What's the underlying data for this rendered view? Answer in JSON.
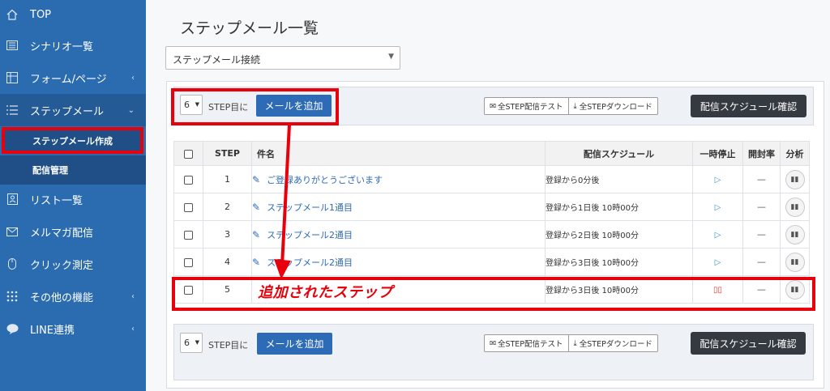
{
  "sidebar": {
    "items": [
      {
        "label": "TOP",
        "icon": "home-icon"
      },
      {
        "label": "シナリオ一覧",
        "icon": "list-icon"
      },
      {
        "label": "フォーム/ページ",
        "icon": "form-icon"
      },
      {
        "label": "ステップメール",
        "icon": "steps-icon"
      },
      {
        "label": "リスト一覧",
        "icon": "contacts-icon"
      },
      {
        "label": "メルマガ配信",
        "icon": "mail-icon"
      },
      {
        "label": "クリック測定",
        "icon": "mouse-icon"
      },
      {
        "label": "その他の機能",
        "icon": "grid-icon"
      },
      {
        "label": "LINE連携",
        "icon": "line-chat-icon"
      }
    ],
    "sub_items": [
      {
        "label": "ステップメール作成"
      },
      {
        "label": "配信管理"
      }
    ]
  },
  "page": {
    "title": "ステップメール一覧",
    "selector_value": "ステップメール接続"
  },
  "toolbar": {
    "step_value": "6",
    "step_suffix": "STEP目に",
    "add_mail": "メールを追加",
    "test_all": "全STEP配信テスト",
    "download_all": "全STEPダウンロード",
    "schedule_confirm": "配信スケジュール確認"
  },
  "table": {
    "headers": {
      "step": "STEP",
      "subject": "件名",
      "schedule": "配信スケジュール",
      "pause": "一時停止",
      "open_rate": "開封率",
      "analysis": "分析"
    },
    "rows": [
      {
        "step": "1",
        "subject": "ご登録ありがとうございます",
        "schedule": "登録から0分後",
        "paused": false,
        "open_rate": "—"
      },
      {
        "step": "2",
        "subject": "ステップメール1通目",
        "schedule": "登録から1日後 10時00分",
        "paused": false,
        "open_rate": "—"
      },
      {
        "step": "3",
        "subject": "ステップメール2通目",
        "schedule": "登録から2日後 10時00分",
        "paused": false,
        "open_rate": "—"
      },
      {
        "step": "4",
        "subject": "ステップメール2通目",
        "schedule": "登録から3日後 10時00分",
        "paused": false,
        "open_rate": "—"
      },
      {
        "step": "5",
        "subject": "",
        "schedule": "登録から3日後 10時00分",
        "paused": true,
        "open_rate": "—"
      }
    ]
  },
  "annotation": {
    "added_step": "追加されたステップ",
    "color": "#e8000b"
  },
  "colors": {
    "sidebar": "#2b6cb0",
    "primary_button": "#2d6bb6",
    "dark_button": "#343a40"
  }
}
